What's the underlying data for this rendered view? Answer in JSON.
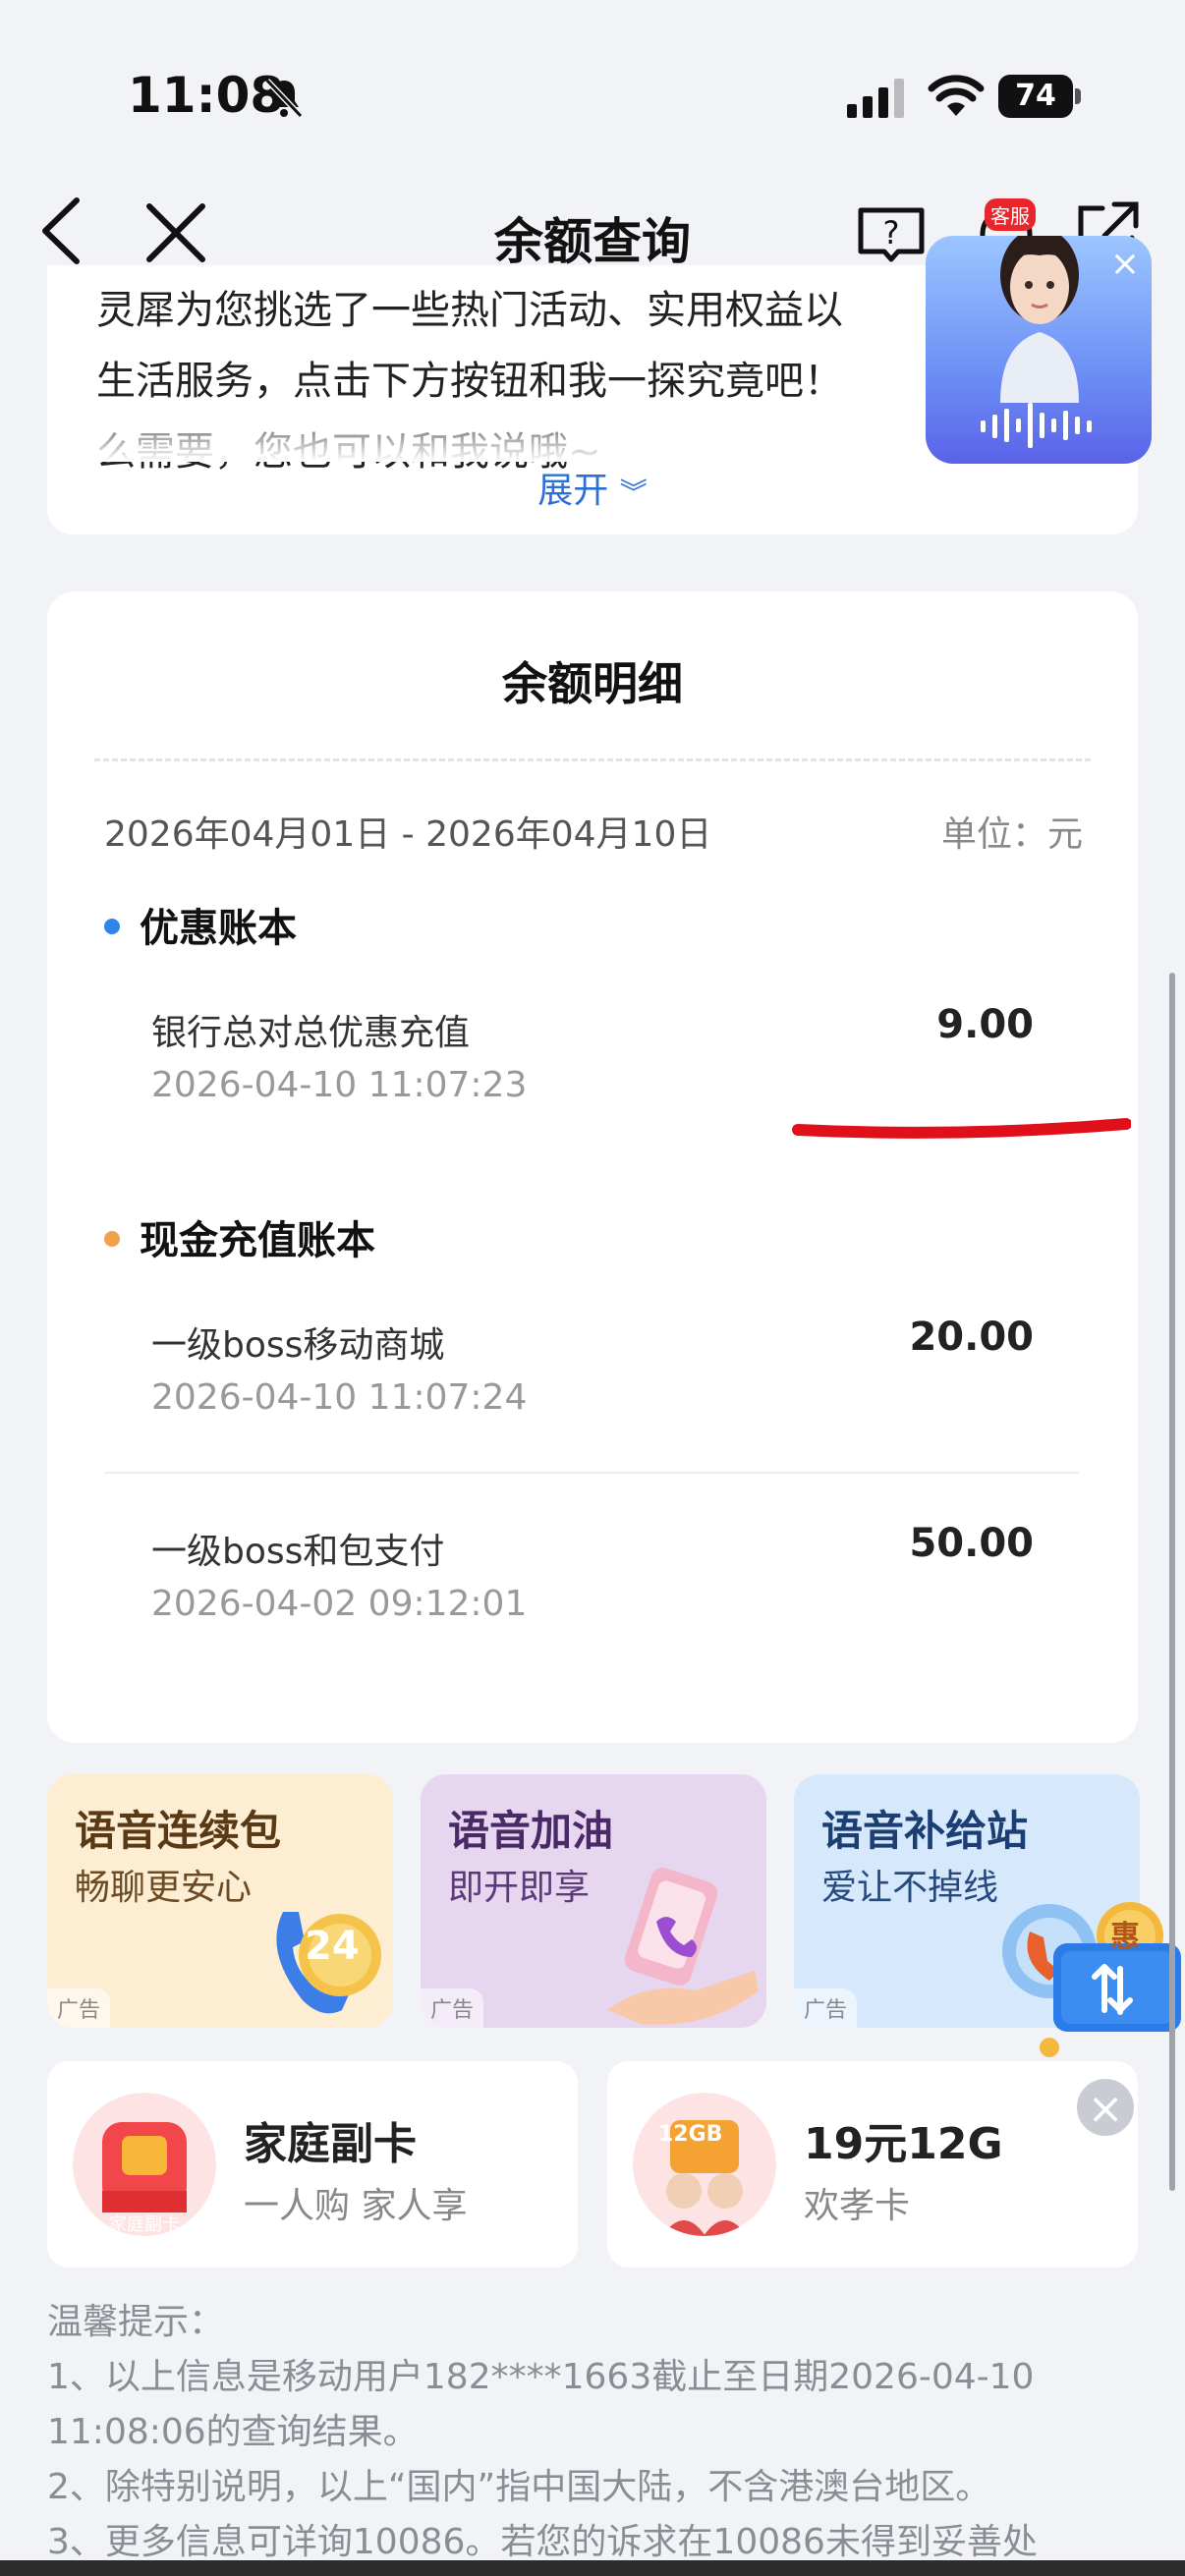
{
  "status_bar": {
    "time": "11:08",
    "battery": "74"
  },
  "nav": {
    "title": "余额查询",
    "service_badge": "客服"
  },
  "intro": {
    "lines": [
      "灵犀为您挑选了一些热门活动、实用权益以",
      "生活服务，点击下方按钮和我一探究竟吧！",
      "么需要，您也可以和我说哦~"
    ],
    "expand_label": "展开"
  },
  "detail": {
    "title": "余额明细",
    "date_range": "2026年04月01日 - 2026年04月10日",
    "unit": "单位：元",
    "sections": [
      {
        "title": "优惠账本",
        "color": "#2f86e8",
        "rows": [
          {
            "name": "银行总对总优惠充值",
            "time": "2026-04-10 11:07:23",
            "amount": "9.00"
          }
        ]
      },
      {
        "title": "现金充值账本",
        "color": "#f0a24a",
        "rows": [
          {
            "name": "一级boss移动商城",
            "time": "2026-04-10 11:07:24",
            "amount": "20.00"
          },
          {
            "name": "一级boss和包支付",
            "time": "2026-04-02 09:12:01",
            "amount": "50.00"
          }
        ]
      }
    ]
  },
  "promos": [
    {
      "title": "语音连续包",
      "sub": "畅聊更安心",
      "ad": "广告",
      "art": "24",
      "bg": "#fdeed3"
    },
    {
      "title": "语音加油",
      "sub": "即开即享",
      "ad": "广告",
      "bg": "#e7d6f0"
    },
    {
      "title": "语音补给站",
      "sub": "爱让不掉线",
      "ad": "广告",
      "bg": "#d6e8fb"
    }
  ],
  "products": [
    {
      "name": "家庭副卡",
      "sub": "一人购 家人享",
      "icon_label": "家庭副卡"
    },
    {
      "name": "19元12G",
      "sub": "欢孝卡",
      "icon_label": "12GB"
    }
  ],
  "float_badge": "惠",
  "notes": {
    "title": "温馨提示：",
    "lines": [
      "1、以上信息是移动用户182****1663截止至日期2026-04-10",
      "11:08:06的查询结果。",
      "2、除特别说明，以上“国内”指中国大陆，不含港澳台地区。",
      "3、更多信息可详询10086。若您的诉求在10086未得到妥善处"
    ]
  }
}
